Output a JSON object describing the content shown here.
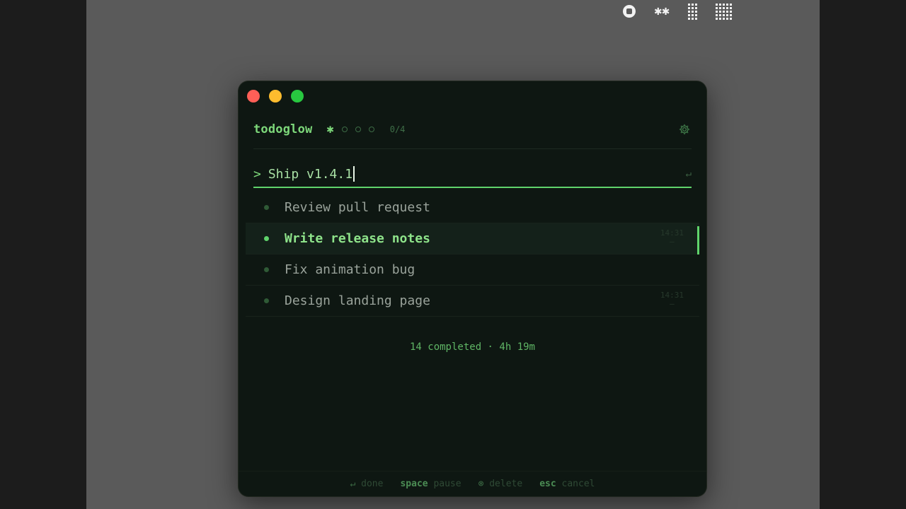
{
  "tray": {
    "icons": [
      "record-icon",
      "asterisk-pair-icon",
      "dots-grid-icon",
      "dots-grid-dense-icon"
    ],
    "asterisks": "✱✱"
  },
  "window": {
    "colors": {
      "accent": "#5fd36b",
      "background": "#0e1712"
    }
  },
  "header": {
    "title": "todoglow",
    "progress_star": "✱",
    "progress_rings": 3,
    "count": "0/4"
  },
  "input": {
    "prompt": ">",
    "value": "Ship v1.4.1",
    "enter_hint": "↵"
  },
  "tasks": [
    {
      "label": "Review pull request",
      "active": false,
      "time": "",
      "time_sub": ""
    },
    {
      "label": "Write release notes",
      "active": true,
      "time": "14:31",
      "time_sub": "–"
    },
    {
      "label": "Fix animation bug",
      "active": false,
      "time": "",
      "time_sub": ""
    },
    {
      "label": "Design landing page",
      "active": false,
      "time": "14:31",
      "time_sub": "–"
    }
  ],
  "summary": "14 completed · 4h 19m",
  "footer": {
    "done": {
      "glyph": "↵",
      "label": "done"
    },
    "pause": {
      "key": "space",
      "label": "pause"
    },
    "delete": {
      "glyph": "⊗",
      "label": "delete"
    },
    "cancel": {
      "key": "esc",
      "label": "cancel"
    }
  }
}
